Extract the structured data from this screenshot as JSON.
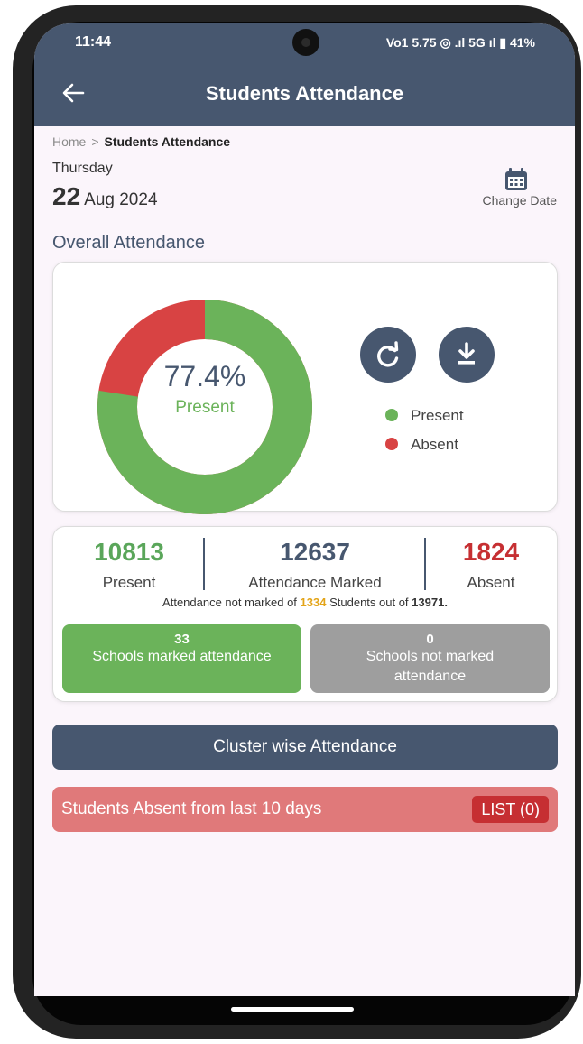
{
  "status_bar": {
    "time": "11:44",
    "indicators": "Vo1 5.75 ◎ .ıl 5G ıl ▮ 41%"
  },
  "header": {
    "title": "Students Attendance",
    "back_icon": "arrow-left-icon"
  },
  "breadcrumb": {
    "home": "Home",
    "separator": ">",
    "current": "Students Attendance"
  },
  "date": {
    "weekday": "Thursday",
    "day": "22",
    "month_year": "Aug 2024",
    "change_label": "Change Date",
    "icon": "calendar-icon"
  },
  "overall": {
    "title": "Overall Attendance",
    "percent_label": "77.4%",
    "percent_caption": "Present",
    "present_fraction": 0.774,
    "legend": [
      {
        "label": "Present",
        "color": "#6bb35a"
      },
      {
        "label": "Absent",
        "color": "#d84343"
      }
    ],
    "refresh_icon": "refresh-icon",
    "download_icon": "download-icon"
  },
  "stats": {
    "present": {
      "value": "10813",
      "label": "Present",
      "color": "#5aa65a"
    },
    "marked": {
      "value": "12637",
      "label": "Attendance Marked",
      "color": "#47576f"
    },
    "absent": {
      "value": "1824",
      "label": "Absent",
      "color": "#c62f32"
    },
    "note_prefix": "Attendance not marked of",
    "note_count": "1334",
    "note_mid": "Students out of",
    "note_total": "13971."
  },
  "schools": {
    "marked": {
      "count": "33",
      "label": "Schools marked attendance",
      "color": "#6bb35a"
    },
    "not_marked": {
      "count": "0",
      "label": "Schools not marked attendance",
      "color": "#9e9e9e"
    }
  },
  "actions": {
    "cluster_label": "Cluster wise Attendance",
    "absent_label": "Students Absent from last 10 days",
    "list_label": "LIST (0)"
  }
}
